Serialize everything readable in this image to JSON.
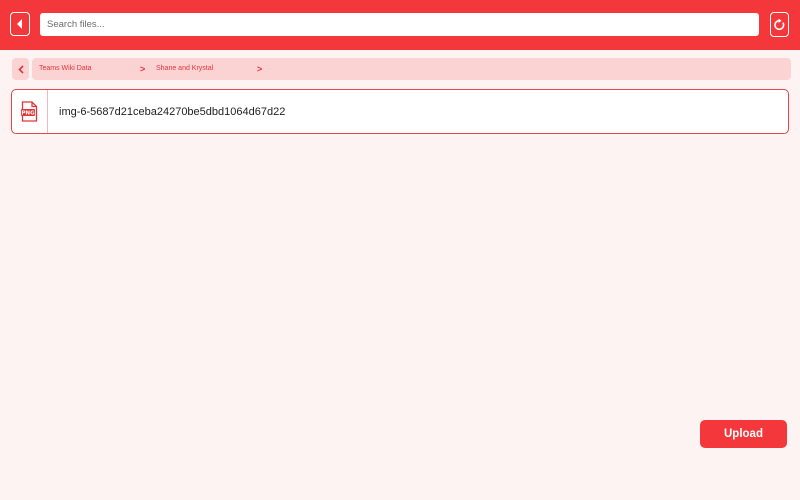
{
  "header": {
    "search": {
      "placeholder": "Search files..."
    },
    "back_icon": "back-arrow-icon",
    "refresh_icon": "refresh-icon"
  },
  "breadcrumb": {
    "items": [
      {
        "label": "Teams Wiki Data"
      },
      {
        "label": "Shane and Krystal"
      }
    ],
    "separator": ">"
  },
  "files": [
    {
      "name": "img-6-5687d21ceba24270be5dbd1064d67d22",
      "type": "PNG",
      "icon": "png-file-icon"
    }
  ],
  "actions": {
    "upload_label": "Upload"
  },
  "colors": {
    "accent": "#f3373b",
    "breadcrumb_bg": "#fbd3d3",
    "page_bg": "#fdf3f3"
  }
}
